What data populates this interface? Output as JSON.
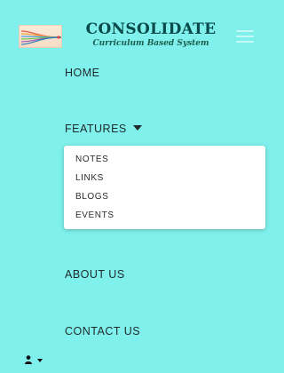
{
  "brand": {
    "title": "CONSOLIDATE",
    "subtitle": "Curriculum Based System",
    "logo_icon": "colorful-lines-logo"
  },
  "nav": {
    "home": "HOME",
    "features": "FEATURES",
    "about": "ABOUT US",
    "contact": "CONTACT US",
    "features_menu": [
      "NOTES",
      "LINKS",
      "BLOGS",
      "EVENTS"
    ]
  },
  "icons": {
    "menu": "hamburger-icon",
    "user": "user-icon",
    "dropdown": "caret-down-icon"
  },
  "colors": {
    "background": "#7FF0EC",
    "title": "#0b4a4a",
    "dropdown_bg": "#ffffff"
  }
}
